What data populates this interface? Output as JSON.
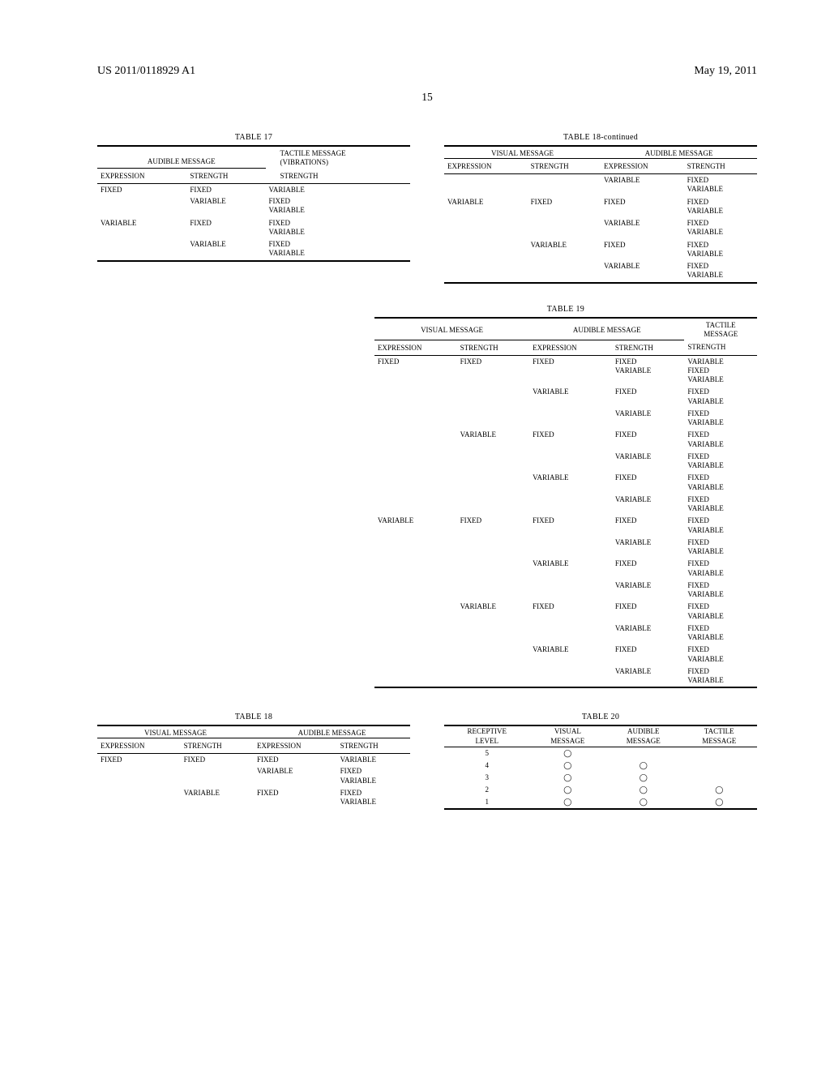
{
  "header": {
    "pub_number": "US 2011/0118929 A1",
    "pub_date": "May 19, 2011",
    "page_number": "15"
  },
  "table17": {
    "title": "TABLE 17",
    "group1": "AUDIBLE MESSAGE",
    "group2": "TACTILE MESSAGE\n(VIBRATIONS)",
    "sub": [
      "EXPRESSION",
      "STRENGTH",
      "STRENGTH"
    ],
    "rows": [
      [
        "FIXED",
        "FIXED",
        "VARIABLE"
      ],
      [
        "",
        "VARIABLE",
        "FIXED\nVARIABLE"
      ],
      [
        "VARIABLE",
        "FIXED",
        "FIXED\nVARIABLE"
      ],
      [
        "",
        "VARIABLE",
        "FIXED\nVARIABLE"
      ]
    ]
  },
  "table18cont": {
    "title": "TABLE 18-continued",
    "group1": "VISUAL MESSAGE",
    "group2": "AUDIBLE MESSAGE",
    "sub": [
      "EXPRESSION",
      "STRENGTH",
      "EXPRESSION",
      "STRENGTH"
    ],
    "rows": [
      [
        "",
        "",
        "VARIABLE",
        "FIXED\nVARIABLE"
      ],
      [
        "VARIABLE",
        "FIXED",
        "FIXED",
        "FIXED\nVARIABLE"
      ],
      [
        "",
        "",
        "VARIABLE",
        "FIXED\nVARIABLE"
      ],
      [
        "",
        "VARIABLE",
        "FIXED",
        "FIXED\nVARIABLE"
      ],
      [
        "",
        "",
        "VARIABLE",
        "FIXED\nVARIABLE"
      ]
    ]
  },
  "table19": {
    "title": "TABLE 19",
    "group1": "VISUAL MESSAGE",
    "group2": "AUDIBLE MESSAGE",
    "group3": "TACTILE\nMESSAGE",
    "sub": [
      "EXPRESSION",
      "STRENGTH",
      "EXPRESSION",
      "STRENGTH",
      "STRENGTH"
    ],
    "rows": [
      [
        "FIXED",
        "FIXED",
        "FIXED",
        "FIXED\nVARIABLE",
        "VARIABLE\nFIXED\nVARIABLE"
      ],
      [
        "",
        "",
        "VARIABLE",
        "FIXED",
        "FIXED\nVARIABLE"
      ],
      [
        "",
        "",
        "",
        "VARIABLE",
        "FIXED\nVARIABLE"
      ],
      [
        "",
        "VARIABLE",
        "FIXED",
        "FIXED",
        "FIXED\nVARIABLE"
      ],
      [
        "",
        "",
        "",
        "VARIABLE",
        "FIXED\nVARIABLE"
      ],
      [
        "",
        "",
        "VARIABLE",
        "FIXED",
        "FIXED\nVARIABLE"
      ],
      [
        "",
        "",
        "",
        "VARIABLE",
        "FIXED\nVARIABLE"
      ],
      [
        "VARIABLE",
        "FIXED",
        "FIXED",
        "FIXED",
        "FIXED\nVARIABLE"
      ],
      [
        "",
        "",
        "",
        "VARIABLE",
        "FIXED\nVARIABLE"
      ],
      [
        "",
        "",
        "VARIABLE",
        "FIXED",
        "FIXED\nVARIABLE"
      ],
      [
        "",
        "",
        "",
        "VARIABLE",
        "FIXED\nVARIABLE"
      ],
      [
        "",
        "VARIABLE",
        "FIXED",
        "FIXED",
        "FIXED\nVARIABLE"
      ],
      [
        "",
        "",
        "",
        "VARIABLE",
        "FIXED\nVARIABLE"
      ],
      [
        "",
        "",
        "VARIABLE",
        "FIXED",
        "FIXED\nVARIABLE"
      ],
      [
        "",
        "",
        "",
        "VARIABLE",
        "FIXED\nVARIABLE"
      ]
    ]
  },
  "table18": {
    "title": "TABLE 18",
    "group1": "VISUAL MESSAGE",
    "group2": "AUDIBLE MESSAGE",
    "sub": [
      "EXPRESSION",
      "STRENGTH",
      "EXPRESSION",
      "STRENGTH"
    ],
    "rows": [
      [
        "FIXED",
        "FIXED",
        "FIXED",
        "VARIABLE"
      ],
      [
        "",
        "",
        "VARIABLE",
        "FIXED\nVARIABLE"
      ],
      [
        "",
        "VARIABLE",
        "FIXED",
        "FIXED\nVARIABLE"
      ]
    ]
  },
  "table20": {
    "title": "TABLE 20",
    "sub": [
      "RECEPTIVE\nLEVEL",
      "VISUAL\nMESSAGE",
      "AUDIBLE\nMESSAGE",
      "TACTILE\nMESSAGE"
    ],
    "rows": [
      [
        "5",
        "◯",
        "",
        ""
      ],
      [
        "4",
        "◯",
        "◯",
        ""
      ],
      [
        "3",
        "◯",
        "◯",
        ""
      ],
      [
        "2",
        "◯",
        "◯",
        "◯"
      ],
      [
        "1",
        "◯",
        "◯",
        "◯"
      ]
    ]
  }
}
